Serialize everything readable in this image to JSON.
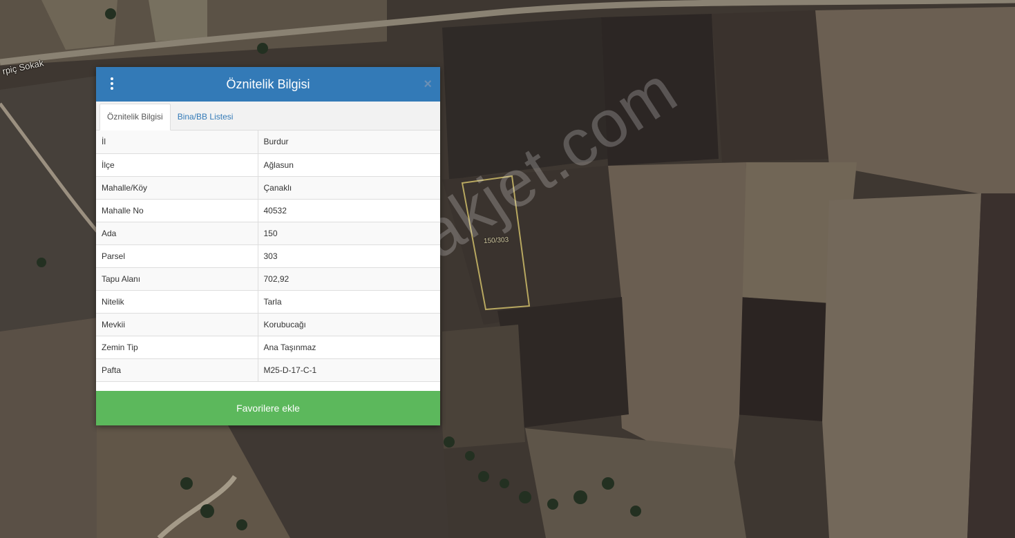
{
  "map": {
    "road_label": "rpiç Sokak",
    "parcel_label": "150/303",
    "watermark": "emlakjet.com"
  },
  "panel": {
    "title": "Öznitelik Bilgisi",
    "menu_icon": "vertical-dots-icon",
    "close_icon": "close-icon",
    "close_glyph": "×",
    "tabs": [
      {
        "label": "Öznitelik Bilgisi",
        "active": true
      },
      {
        "label": "Bina/BB Listesi",
        "active": false
      }
    ],
    "rows": [
      {
        "key": "İl",
        "value": "Burdur"
      },
      {
        "key": "İlçe",
        "value": "Ağlasun"
      },
      {
        "key": "Mahalle/Köy",
        "value": "Çanaklı"
      },
      {
        "key": "Mahalle No",
        "value": "40532"
      },
      {
        "key": "Ada",
        "value": "150"
      },
      {
        "key": "Parsel",
        "value": "303"
      },
      {
        "key": "Tapu Alanı",
        "value": "702,92"
      },
      {
        "key": "Nitelik",
        "value": "Tarla"
      },
      {
        "key": "Mevkii",
        "value": "Korubucağı"
      },
      {
        "key": "Zemin Tip",
        "value": "Ana Taşınmaz"
      },
      {
        "key": "Pafta",
        "value": "M25-D-17-C-1"
      }
    ],
    "favorite_button": "Favorilere ekle"
  },
  "colors": {
    "header": "#337ab7",
    "favorite": "#5cb85c",
    "parcel_outline": "#b8a860"
  }
}
